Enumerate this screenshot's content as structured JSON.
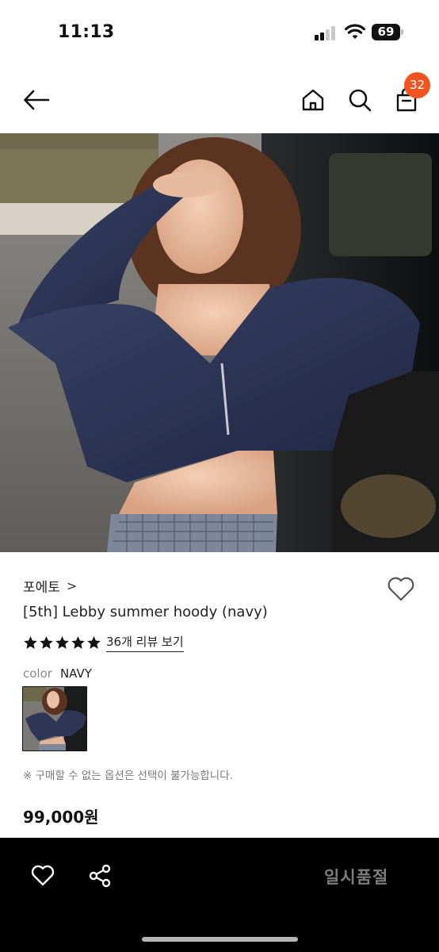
{
  "status_bar": {
    "time": "11:13",
    "battery": "69"
  },
  "header": {
    "cart_count": "32"
  },
  "product": {
    "brand": "포에토",
    "brand_chevron": ">",
    "title": "[5th] Lebby summer hoody (navy)",
    "rating_stars": 5,
    "review_link": "36개 리뷰 보기",
    "option_label": "color",
    "option_value": "NAVY",
    "notice": "※ 구매할 수 없는 옵션은 선택이 불가능합니다.",
    "price": "99,000원"
  },
  "bottom_bar": {
    "soldout_label": "일시품절"
  },
  "icons": [
    "back-arrow-icon",
    "home-icon",
    "search-icon",
    "shopping-bag-icon",
    "heart-icon",
    "star-icon",
    "share-icon"
  ],
  "colors": {
    "badge": "#f2541f",
    "bottom_bar": "#000000",
    "soldout_text": "#7d7d7d"
  }
}
